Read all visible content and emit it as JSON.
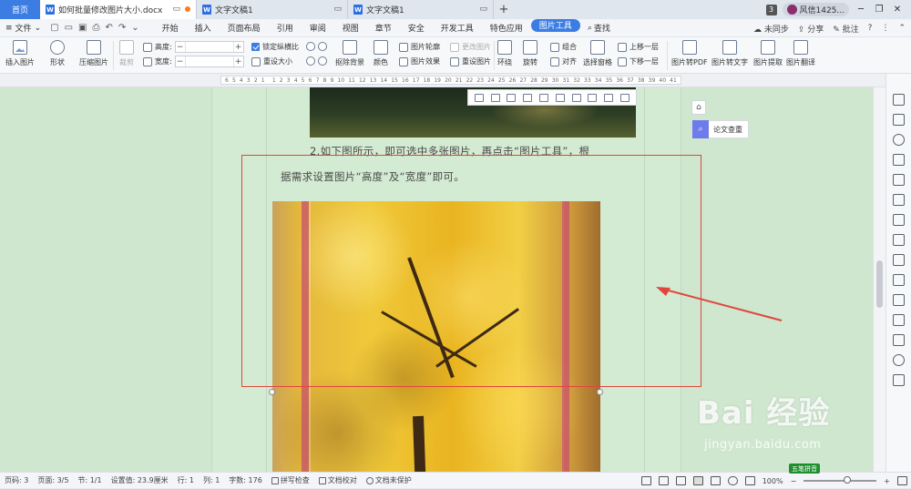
{
  "titlebar": {
    "home_label": "首页",
    "tabs": [
      {
        "label": "如何批量修改图片大小.docx",
        "active": true
      },
      {
        "label": "文字文稿1",
        "active": false
      },
      {
        "label": "文字文稿1",
        "active": false
      }
    ],
    "notification_count": "3",
    "user_name": "风信1425..."
  },
  "menubar": {
    "file_label": "文件",
    "tabs": [
      "开始",
      "插入",
      "页面布局",
      "引用",
      "审阅",
      "视图",
      "章节",
      "安全",
      "开发工具",
      "特色应用",
      "图片工具"
    ],
    "active_tab": "图片工具",
    "search_label": "查找",
    "right": {
      "sync": "未同步",
      "share": "分享",
      "annotate": "批注",
      "help": "?"
    }
  },
  "ribbon": {
    "insert_picture": "插入图片",
    "shape": "形状",
    "compress": "压缩图片",
    "crop": "裁剪",
    "height_label": "高度:",
    "width_label": "宽度:",
    "lock_ratio": "锁定纵横比",
    "reset_size": "重设大小",
    "remove_bg": "抠除背景",
    "color": "颜色",
    "picture_outline": "图片轮廓",
    "picture_effect": "图片效果",
    "change_picture": "更改图片",
    "reset_picture": "重设图片",
    "wrap": "环绕",
    "rotate": "旋转",
    "group": "组合",
    "align": "对齐",
    "selection_pane": "选择窗格",
    "bring_forward": "上移一层",
    "send_backward": "下移一层",
    "to_pdf": "图片转PDF",
    "to_text": "图片转文字",
    "extract": "图片提取",
    "translate": "图片翻译"
  },
  "ruler": {
    "ticks": [
      "6",
      "5",
      "4",
      "3",
      "2",
      "1",
      "",
      "1",
      "2",
      "3",
      "4",
      "5",
      "6",
      "7",
      "8",
      "9",
      "10",
      "11",
      "12",
      "13",
      "14",
      "15",
      "16",
      "17",
      "18",
      "19",
      "20",
      "21",
      "22",
      "23",
      "24",
      "25",
      "26",
      "27",
      "28",
      "29",
      "30",
      "31",
      "32",
      "33",
      "34",
      "35",
      "36",
      "37",
      "38",
      "39",
      "40",
      "41"
    ]
  },
  "document": {
    "line1": "2.如下图所示，即可选中多张图片，再点击“图片工具”，根",
    "line2": "据需求设置图片“高度”及“宽度”即可。",
    "paper_check": "论文查重"
  },
  "watermark": {
    "brand": "Bai 经验",
    "url": "jingyan.baidu.com"
  },
  "statusbar": {
    "page_num": "页码: 3",
    "page": "页面: 3/5",
    "section": "节: 1/1",
    "setting": "设置值: 23.9厘米",
    "row": "行: 1",
    "col": "列: 1",
    "word_count": "字数: 176",
    "spell_check": "拼写检查",
    "proofread": "文档校对",
    "not_protected": "文档未保护",
    "zoom": "100%",
    "ime": "五笔拼音"
  },
  "colors": {
    "accent": "#3b7de3",
    "doc_bg": "#cfe6cf",
    "highlight_box": "#e0463c",
    "paper_check_icon": "#6e7bea"
  }
}
